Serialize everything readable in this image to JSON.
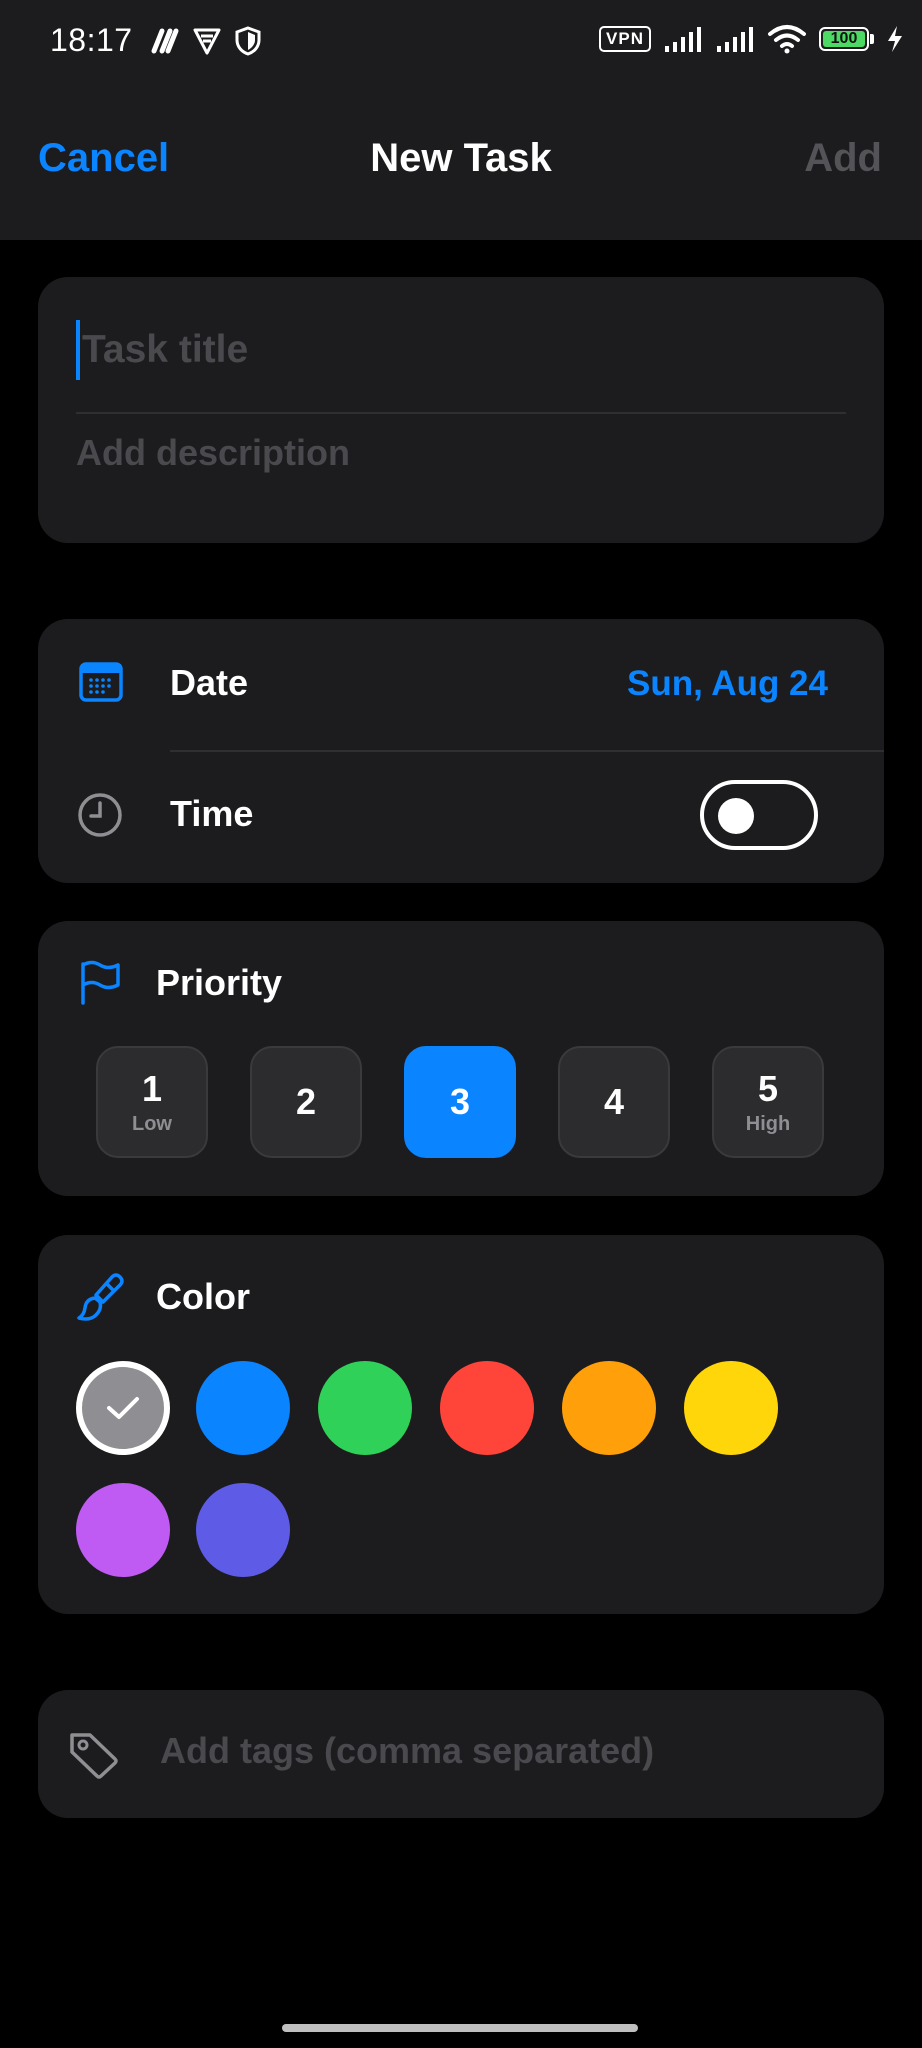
{
  "status_bar": {
    "time": "18:17",
    "vpn": "VPN",
    "battery": "100"
  },
  "nav": {
    "cancel": "Cancel",
    "title": "New Task",
    "add": "Add"
  },
  "task": {
    "title_placeholder": "Task title",
    "description_placeholder": "Add description"
  },
  "date": {
    "label": "Date",
    "value": "Sun, Aug 24"
  },
  "time": {
    "label": "Time",
    "enabled": false
  },
  "priority": {
    "label": "Priority",
    "selected": 3,
    "options": [
      {
        "num": "1",
        "sub": "Low"
      },
      {
        "num": "2",
        "sub": ""
      },
      {
        "num": "3",
        "sub": ""
      },
      {
        "num": "4",
        "sub": ""
      },
      {
        "num": "5",
        "sub": "High"
      }
    ]
  },
  "color": {
    "label": "Color",
    "selected": "gray",
    "options": [
      {
        "name": "gray",
        "hex": "#8e8e93"
      },
      {
        "name": "blue",
        "hex": "#0a84ff"
      },
      {
        "name": "green",
        "hex": "#30d158"
      },
      {
        "name": "red",
        "hex": "#ff453a"
      },
      {
        "name": "orange",
        "hex": "#ff9f0a"
      },
      {
        "name": "yellow",
        "hex": "#ffd60a"
      },
      {
        "name": "purple",
        "hex": "#bf5af2"
      },
      {
        "name": "indigo",
        "hex": "#5e5ce6"
      }
    ]
  },
  "tags": {
    "placeholder": "Add tags (comma separated)"
  },
  "theme": {
    "accent": "#0a84ff",
    "background": "#000000",
    "card": "#1c1c1e"
  }
}
